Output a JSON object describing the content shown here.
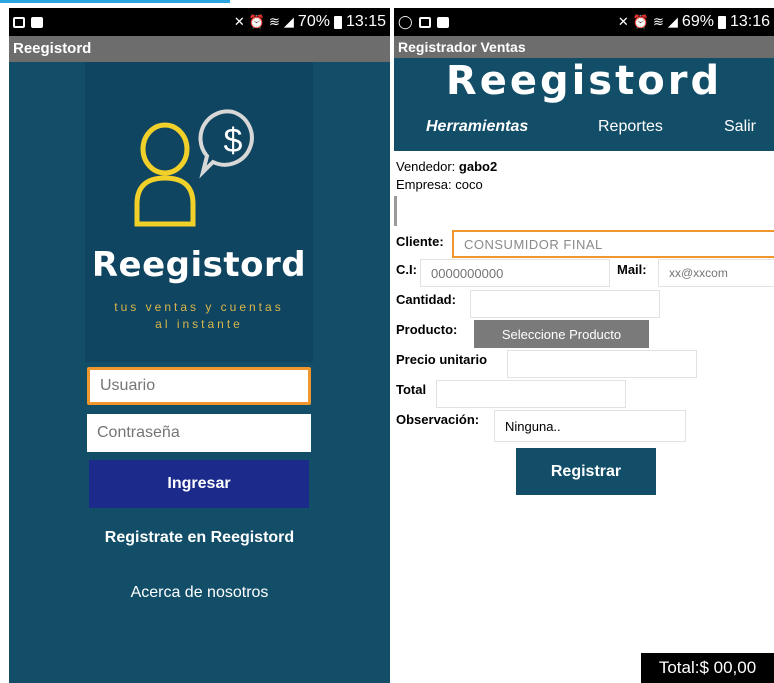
{
  "left": {
    "status": {
      "percent": "70%",
      "time": "13:15"
    },
    "appbar_title": "Reegistord",
    "logo": {
      "title": "Reegistord",
      "tagline_line1": "tus ventas y cuentas",
      "tagline_line2": "al instante"
    },
    "user_placeholder": "Usuario",
    "password_placeholder": "Contraseña",
    "login_button": "Ingresar",
    "register_link": "Registrate en Reegistord",
    "about_link": "Acerca de nosotros"
  },
  "right": {
    "status": {
      "percent": "69%",
      "time": "13:16"
    },
    "appbar_title": "Registrador Ventas",
    "banner_title": "Reegistord",
    "nav": {
      "tools": "Herramientas",
      "reports": "Reportes",
      "exit": "Salir"
    },
    "vendor_label": "Vendedor:",
    "vendor_value": "gabo2",
    "company_label": "Empresa:",
    "company_value": "coco",
    "form": {
      "client_label": "Cliente:",
      "client_value": "CONSUMIDOR FINAL",
      "ci_label": "C.I:",
      "ci_placeholder": "0000000000",
      "mail_label": "Mail:",
      "mail_placeholder": "xx@xxcom",
      "quantity_label": "Cantidad:",
      "product_label": "Producto:",
      "product_button": "Seleccione Producto",
      "price_label": "Precio unitario",
      "total_label": "Total",
      "observation_label": "Observación:",
      "observation_value": "Ninguna..",
      "register_button": "Registrar"
    },
    "total_footer": "Total:$ 00,00"
  },
  "colors": {
    "primary": "#124e68",
    "accent": "#f0962c",
    "login_button": "#1c2a8c",
    "logo_gold": "#d9b64a"
  },
  "icons": [
    "image-icon",
    "video-icon",
    "whatsapp-icon",
    "mute-icon",
    "alarm-icon",
    "wifi-icon",
    "signal-icon",
    "battery-icon",
    "person-icon",
    "dollar-chat-icon"
  ]
}
